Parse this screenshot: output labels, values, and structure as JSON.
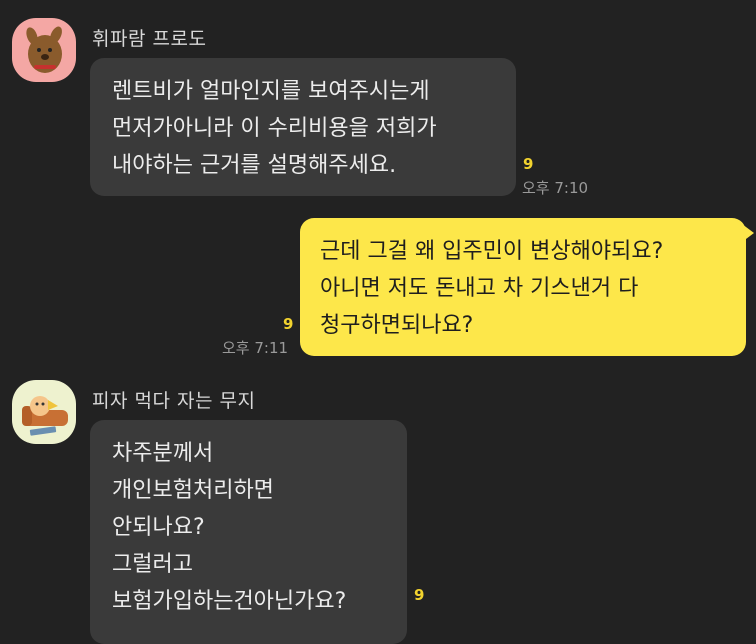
{
  "messages": [
    {
      "sender": "휘파람 프로도",
      "text": "렌트비가 얼마인지를 보여주시는게\n먼저가아니라 이 수리비용을 저희가\n내야하는 근거를 설명해주세요.",
      "unread": "9",
      "time": "오후 7:10"
    },
    {
      "text": "근데 그걸 왜 입주민이 변상해야되요?\n아니면 저도 돈내고 차 기스낸거 다\n청구하면되나요?",
      "unread": "9",
      "time": "오후 7:11"
    },
    {
      "sender": "피자 먹다 자는 무지",
      "text": "차주분께서\n개인보험처리하면\n안되나요?\n그럴러고\n보험가입하는건아닌가요?",
      "unread": "9"
    }
  ],
  "colors": {
    "background": "#222222",
    "incoming_bubble": "#3a3a3a",
    "outgoing_bubble": "#fde74a",
    "unread": "#f2d32e"
  },
  "icons": [
    "frodo-avatar-icon",
    "muzi-avatar-icon"
  ]
}
